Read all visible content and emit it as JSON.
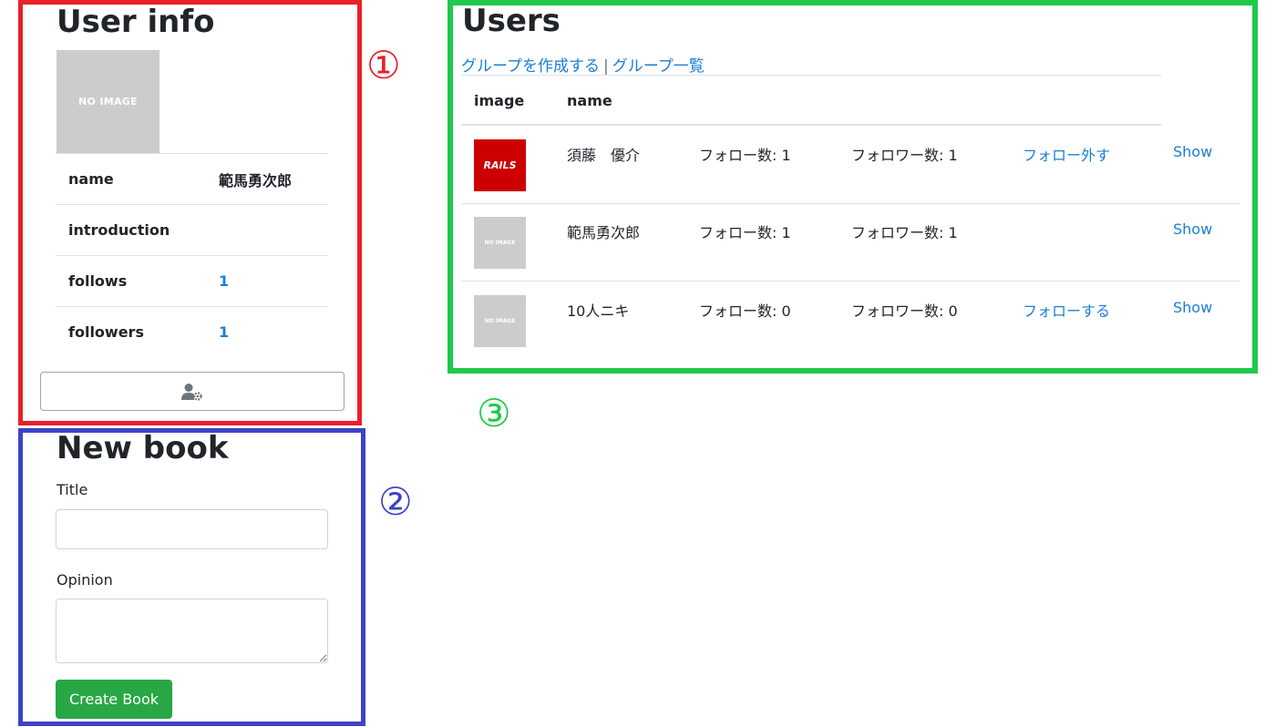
{
  "markers": [
    "①",
    "②",
    "③"
  ],
  "user_info": {
    "title": "User info",
    "image_text": "NO IMAGE",
    "rows": [
      {
        "label": "name",
        "value": "範馬勇次郎"
      },
      {
        "label": "introduction",
        "value": ""
      },
      {
        "label": "follows",
        "value": "1"
      },
      {
        "label": "followers",
        "value": "1"
      }
    ],
    "edit_icon": "user-cog-icon"
  },
  "new_book": {
    "title": "New book",
    "title_label": "Title",
    "title_value": "",
    "opinion_label": "Opinion",
    "opinion_value": "",
    "submit_label": "Create Book",
    "submit_color": "#28a745"
  },
  "users": {
    "title": "Users",
    "create_group_link": "グループを作成する",
    "separator": "|",
    "group_list_link": "グループ一覧",
    "headers": {
      "image": "image",
      "name": "name"
    },
    "rows": [
      {
        "avatar": "RAILS",
        "name": "須藤　優介",
        "follows": "フォロー数: 1",
        "followers": "フォロワー数: 1",
        "action": "フォロー外す",
        "show": "Show"
      },
      {
        "avatar": "NO IMAGE",
        "name": "範馬勇次郎",
        "follows": "フォロー数: 1",
        "followers": "フォロワー数: 1",
        "action": "",
        "show": "Show"
      },
      {
        "avatar": "NO IMAGE",
        "name": "10人ニキ",
        "follows": "フォロー数: 0",
        "followers": "フォロワー数: 0",
        "action": "フォローする",
        "show": "Show"
      }
    ],
    "link_color": "#1a7fd6"
  },
  "annotation_colors": {
    "red": "#e8202a",
    "blue": "#3d43c6",
    "green": "#1ec94b"
  }
}
